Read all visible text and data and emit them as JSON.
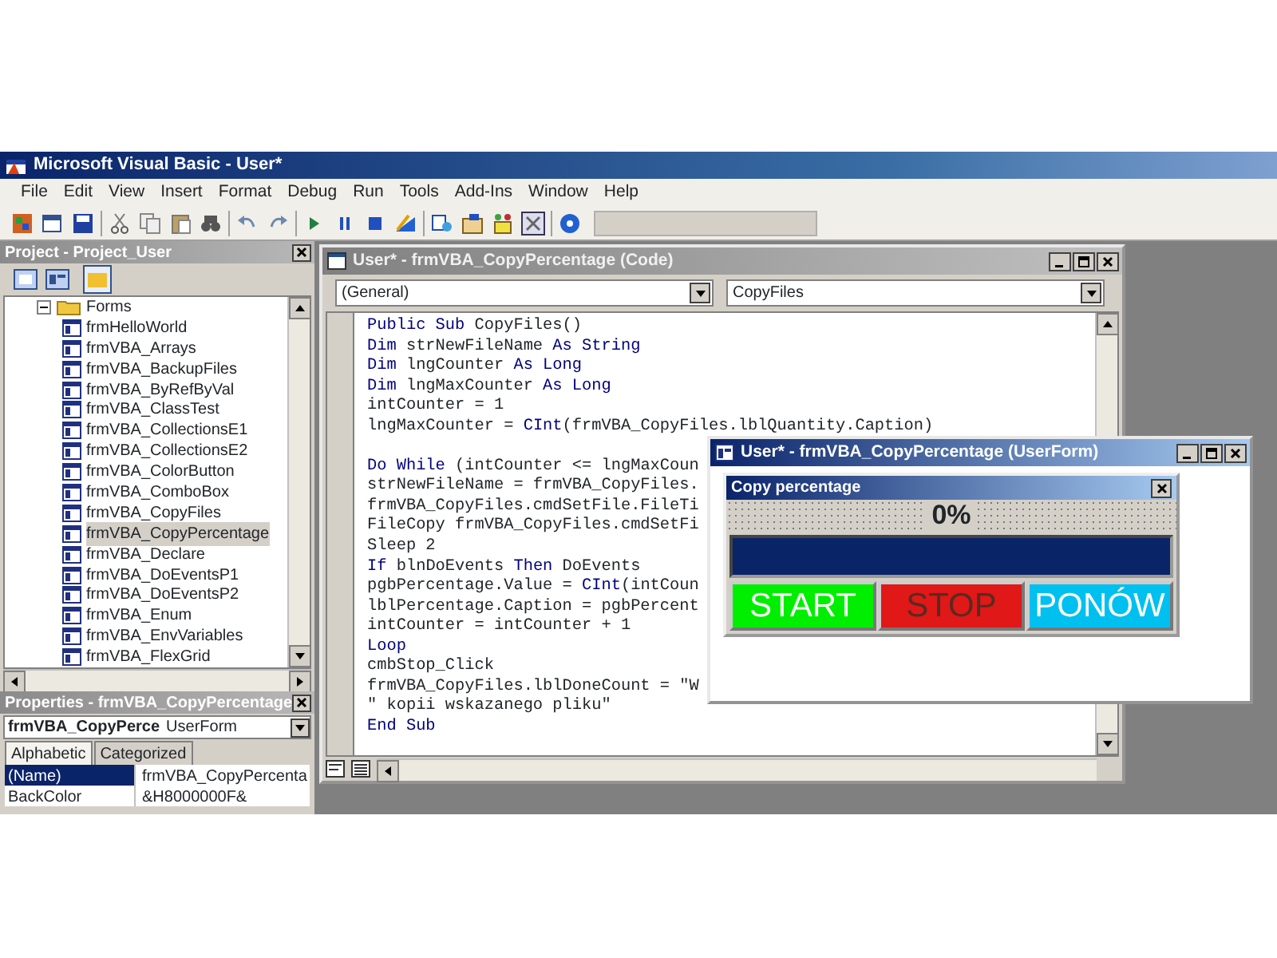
{
  "window": {
    "title": "Microsoft Visual Basic - User*"
  },
  "menu": [
    "File",
    "Edit",
    "View",
    "Insert",
    "Format",
    "Debug",
    "Run",
    "Tools",
    "Add-Ins",
    "Window",
    "Help"
  ],
  "project_pane": {
    "title": "Project - Project_User",
    "tree": [
      {
        "label": "Forms",
        "expanded": true,
        "children": [
          {
            "label": "frmHelloWorld",
            "selected": false
          },
          {
            "label": "frmVBA_Arrays",
            "selected": false
          },
          {
            "label": "frmVBA_BackupFiles",
            "selected": false
          },
          {
            "label": "frmVBA_ByRefByVal",
            "selected": false
          },
          {
            "label": "frmVBA_ClassTest",
            "selected": false
          },
          {
            "label": "frmVBA_CollectionsE1",
            "selected": false
          },
          {
            "label": "frmVBA_CollectionsE2",
            "selected": false
          },
          {
            "label": "frmVBA_ColorButton",
            "selected": false
          },
          {
            "label": "frmVBA_ComboBox",
            "selected": false
          },
          {
            "label": "frmVBA_CopyFiles",
            "selected": false
          },
          {
            "label": "frmVBA_CopyPercentage",
            "selected": true
          },
          {
            "label": "frmVBA_Declare",
            "selected": false
          },
          {
            "label": "frmVBA_DoEventsP1",
            "selected": false
          },
          {
            "label": "frmVBA_DoEventsP2",
            "selected": false
          },
          {
            "label": "frmVBA_Enum",
            "selected": false
          },
          {
            "label": "frmVBA_EnvVariables",
            "selected": false
          },
          {
            "label": "frmVBA_FlexGrid",
            "selected": false
          }
        ]
      }
    ]
  },
  "properties_pane": {
    "title": "Properties - frmVBA_CopyPercentage",
    "object_name": "frmVBA_CopyPerce",
    "object_type": "UserForm",
    "tabs": [
      {
        "label": "Alphabetic",
        "selected": true
      },
      {
        "label": "Categorized",
        "selected": false
      }
    ],
    "rows": [
      {
        "name": "(Name)",
        "value": "frmVBA_CopyPercenta",
        "selected": true
      },
      {
        "name": "BackColor",
        "value": "&H8000000F&",
        "selected": false
      }
    ]
  },
  "code_window": {
    "title": "User* - frmVBA_CopyPercentage (Code)",
    "object_combo": "(General)",
    "procedure_combo": "CopyFiles",
    "lines": [
      {
        "kind": "code",
        "segments": [
          {
            "text": "Public Sub",
            "kind": "keyword"
          },
          {
            "text": " CopyFiles()",
            "kind": "plain"
          }
        ]
      },
      {
        "kind": "code",
        "segments": [
          {
            "text": "Dim",
            "kind": "keyword"
          },
          {
            "text": " strNewFileName ",
            "kind": "plain"
          },
          {
            "text": "As String",
            "kind": "keyword"
          }
        ]
      },
      {
        "kind": "code",
        "segments": [
          {
            "text": "Dim",
            "kind": "keyword"
          },
          {
            "text": " lngCounter ",
            "kind": "plain"
          },
          {
            "text": "As Long",
            "kind": "keyword"
          }
        ]
      },
      {
        "kind": "code",
        "segments": [
          {
            "text": "Dim",
            "kind": "keyword"
          },
          {
            "text": " lngMaxCounter ",
            "kind": "plain"
          },
          {
            "text": "As Long",
            "kind": "keyword"
          }
        ]
      },
      {
        "kind": "code",
        "segments": [
          {
            "text": "intCounter = 1",
            "kind": "plain"
          }
        ]
      },
      {
        "kind": "code",
        "segments": [
          {
            "text": "lngMaxCounter = ",
            "kind": "plain"
          },
          {
            "text": "CInt",
            "kind": "keyword"
          },
          {
            "text": "(frmVBA_CopyFiles.lblQuantity.Caption)",
            "kind": "plain"
          }
        ]
      },
      {
        "kind": "blank"
      },
      {
        "kind": "code",
        "segments": [
          {
            "text": "Do While",
            "kind": "keyword"
          },
          {
            "text": " (intCounter <= lngMaxCoun",
            "kind": "plain"
          }
        ]
      },
      {
        "kind": "code",
        "segments": [
          {
            "text": "strNewFileName = frmVBA_CopyFiles.",
            "kind": "plain"
          }
        ]
      },
      {
        "kind": "code",
        "segments": [
          {
            "text": "frmVBA_CopyFiles.cmdSetFile.FileTi",
            "kind": "plain"
          }
        ]
      },
      {
        "kind": "code",
        "segments": [
          {
            "text": "FileCopy frmVBA_CopyFiles.cmdSetFi",
            "kind": "plain"
          }
        ]
      },
      {
        "kind": "code",
        "segments": [
          {
            "text": "Sleep 2",
            "kind": "plain"
          }
        ]
      },
      {
        "kind": "code",
        "segments": [
          {
            "text": "If",
            "kind": "keyword"
          },
          {
            "text": " blnDoEvents ",
            "kind": "plain"
          },
          {
            "text": "Then",
            "kind": "keyword"
          },
          {
            "text": " DoEvents",
            "kind": "plain"
          }
        ]
      },
      {
        "kind": "code",
        "segments": [
          {
            "text": "pgbPercentage.Value = ",
            "kind": "plain"
          },
          {
            "text": "CInt",
            "kind": "keyword"
          },
          {
            "text": "(intCoun",
            "kind": "plain"
          }
        ]
      },
      {
        "kind": "code",
        "segments": [
          {
            "text": "lblPercentage.Caption = pgbPercent",
            "kind": "plain"
          }
        ]
      },
      {
        "kind": "code",
        "segments": [
          {
            "text": "intCounter = intCounter + 1",
            "kind": "plain"
          }
        ]
      },
      {
        "kind": "code",
        "segments": [
          {
            "text": "Loop",
            "kind": "keyword"
          }
        ]
      },
      {
        "kind": "code",
        "segments": [
          {
            "text": "cmbStop_Click",
            "kind": "plain"
          }
        ]
      },
      {
        "kind": "code",
        "segments": [
          {
            "text": "frmVBA_CopyFiles.lblDoneCount = \"W",
            "kind": "plain"
          }
        ]
      },
      {
        "kind": "code",
        "segments": [
          {
            "text": "\" kopii wskazanego pliku\"",
            "kind": "plain"
          }
        ]
      },
      {
        "kind": "code",
        "segments": [
          {
            "text": "End Sub",
            "kind": "keyword"
          }
        ]
      }
    ]
  },
  "userform_window": {
    "title": "User* - frmVBA_CopyPercentage (UserForm)",
    "form_caption": "Copy percentage",
    "percentage": "0%",
    "progress": {
      "level": 0
    },
    "buttons": [
      {
        "label": "START",
        "color": "#00ee00",
        "disabled": false
      },
      {
        "label": "STOP",
        "color": "#e01818",
        "disabled": true
      },
      {
        "label": "PONÓW",
        "color": "#00c0f0",
        "disabled": false
      }
    ]
  }
}
